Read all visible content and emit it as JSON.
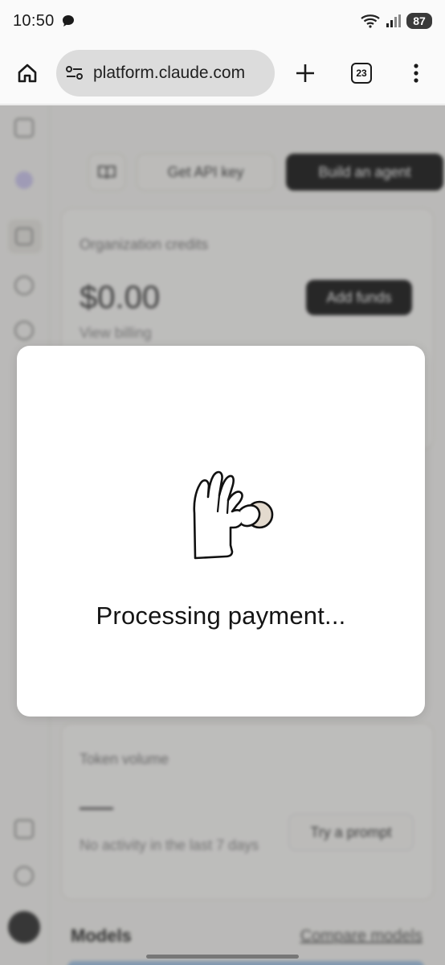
{
  "status_bar": {
    "time": "10:50",
    "battery": "87",
    "icons": [
      "chat-bubble-icon",
      "wifi-icon",
      "signal-icon"
    ]
  },
  "browser": {
    "url": "platform.claude.com",
    "tabs_count": "23",
    "icons": [
      "home-icon",
      "site-settings-icon",
      "new-tab-plus-icon",
      "tabs-icon",
      "more-vert-icon"
    ]
  },
  "background_page": {
    "open_docs_icon": "book-icon",
    "get_api_key": "Get API key",
    "build_agent": "Build an agent",
    "credits_title": "Organization credits",
    "credits_amount": "$0.00",
    "add_funds": "Add funds",
    "view_billing": "View billing",
    "token_title": "Token volume",
    "token_dash": "—",
    "no_activity": "No activity in the last 7 days",
    "try_prompt": "Try a prompt",
    "models_title": "Models",
    "compare_models": "Compare models"
  },
  "modal": {
    "illustration": "hand-holding-coin-icon",
    "message": "Processing payment...",
    "coin_color": "#e3dace"
  }
}
